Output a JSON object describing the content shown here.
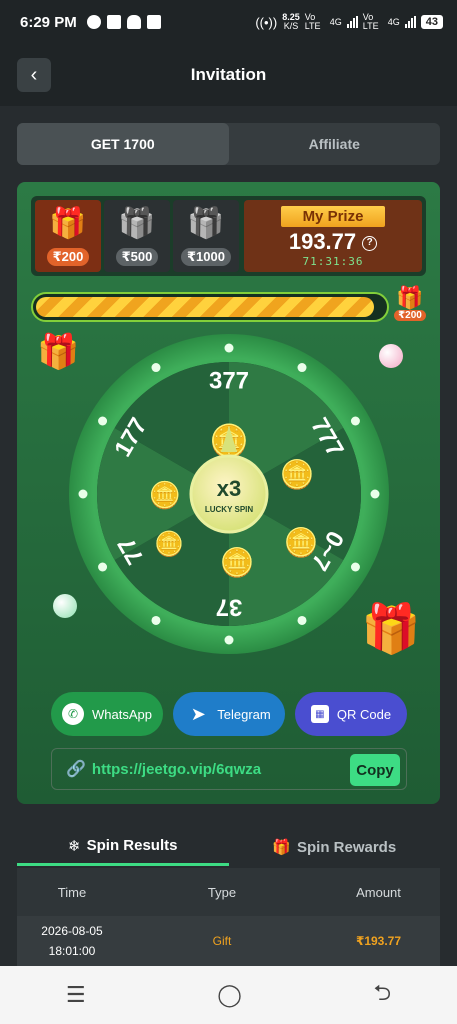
{
  "status": {
    "time": "6:29 PM",
    "speed": "8.25",
    "speed_unit": "K/S",
    "net1": "Vo LTE",
    "net2": "4G",
    "battery": "43"
  },
  "header": {
    "back": "‹",
    "title": "Invitation"
  },
  "tabs": [
    {
      "label": "GET 1700",
      "active": true
    },
    {
      "label": "Affiliate",
      "active": false
    }
  ],
  "prizes": [
    {
      "amount": "₹200",
      "state": "unlocked"
    },
    {
      "amount": "₹500",
      "state": "locked"
    },
    {
      "amount": "₹1000",
      "state": "locked"
    }
  ],
  "my_prize": {
    "label": "My Prize",
    "value": "193.77",
    "help_icon": "question-circle-icon",
    "timer": "71:31:36"
  },
  "progress": {
    "fraction": 0.97,
    "goal_amount": "₹200"
  },
  "wheel": {
    "segments": [
      "777",
      "0~7",
      "37",
      "77",
      "177",
      "377"
    ],
    "center_top": "x3",
    "center_bottom": "LUCKY SPIN"
  },
  "share": {
    "whatsapp": "WhatsApp",
    "telegram": "Telegram",
    "qr": "QR Code"
  },
  "invite_link": {
    "url": "https://jeetgo.vip/6qwza",
    "copy_label": "Copy"
  },
  "results_tabs": [
    {
      "label": "Spin Results",
      "icon": "snowflake-icon",
      "active": true
    },
    {
      "label": "Spin Rewards",
      "icon": "gift-icon",
      "active": false
    }
  ],
  "table": {
    "headers": [
      "Time",
      "Type",
      "Amount"
    ],
    "rows": [
      {
        "date": "2026-08-05",
        "time": "18:01:00",
        "type": "Gift",
        "amount": "₹193.77"
      }
    ]
  },
  "nav": {
    "menu": "☰",
    "home": "◯",
    "back": "⮌"
  },
  "colors": {
    "accent": "#3ddc84",
    "prize_gold": "#f0a21f",
    "game_green": "#2c7a45"
  }
}
